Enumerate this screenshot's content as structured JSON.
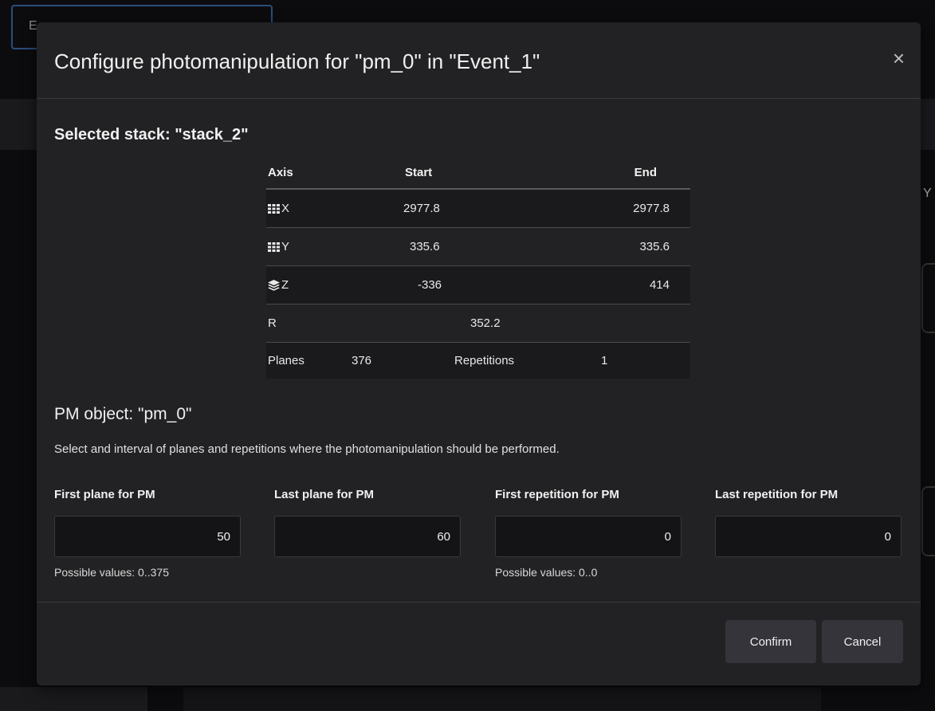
{
  "background": {
    "tab_fragment": "E",
    "right_fragment": "Y"
  },
  "dialog": {
    "title": "Configure photomanipulation for \"pm_0\" in \"Event_1\"",
    "close_glyph": "×"
  },
  "stack": {
    "title": "Selected stack: \"stack_2\"",
    "headers": {
      "axis": "Axis",
      "start": "Start",
      "end": "End"
    },
    "rows": [
      {
        "icon": "grid-icon",
        "axis": "X",
        "start": "2977.8",
        "end": "2977.8"
      },
      {
        "icon": "grid-icon",
        "axis": "Y",
        "start": "335.6",
        "end": "335.6"
      },
      {
        "icon": "layers-icon",
        "axis": "Z",
        "start": "-336",
        "end": "414"
      }
    ],
    "r_label": "R",
    "r_value": "352.2",
    "planes_label": "Planes",
    "planes_value": "376",
    "repetitions_label": "Repetitions",
    "repetitions_value": "1"
  },
  "pm": {
    "title": "PM object: \"pm_0\"",
    "description": "Select and interval of planes and repetitions where the photomanipulation should be performed.",
    "fields": [
      {
        "label": "First plane for PM",
        "value": "50",
        "hint": "Possible values: 0..375"
      },
      {
        "label": "Last plane for PM",
        "value": "60",
        "hint": ""
      },
      {
        "label": "First repetition for PM",
        "value": "0",
        "hint": "Possible values: 0..0"
      },
      {
        "label": "Last repetition for PM",
        "value": "0",
        "hint": ""
      }
    ]
  },
  "buttons": {
    "confirm": "Confirm",
    "cancel": "Cancel"
  },
  "colors": {
    "modal_bg": "#222224",
    "input_bg": "#141416",
    "button_bg": "#34343a",
    "accent_border": "#2a4d7a"
  }
}
